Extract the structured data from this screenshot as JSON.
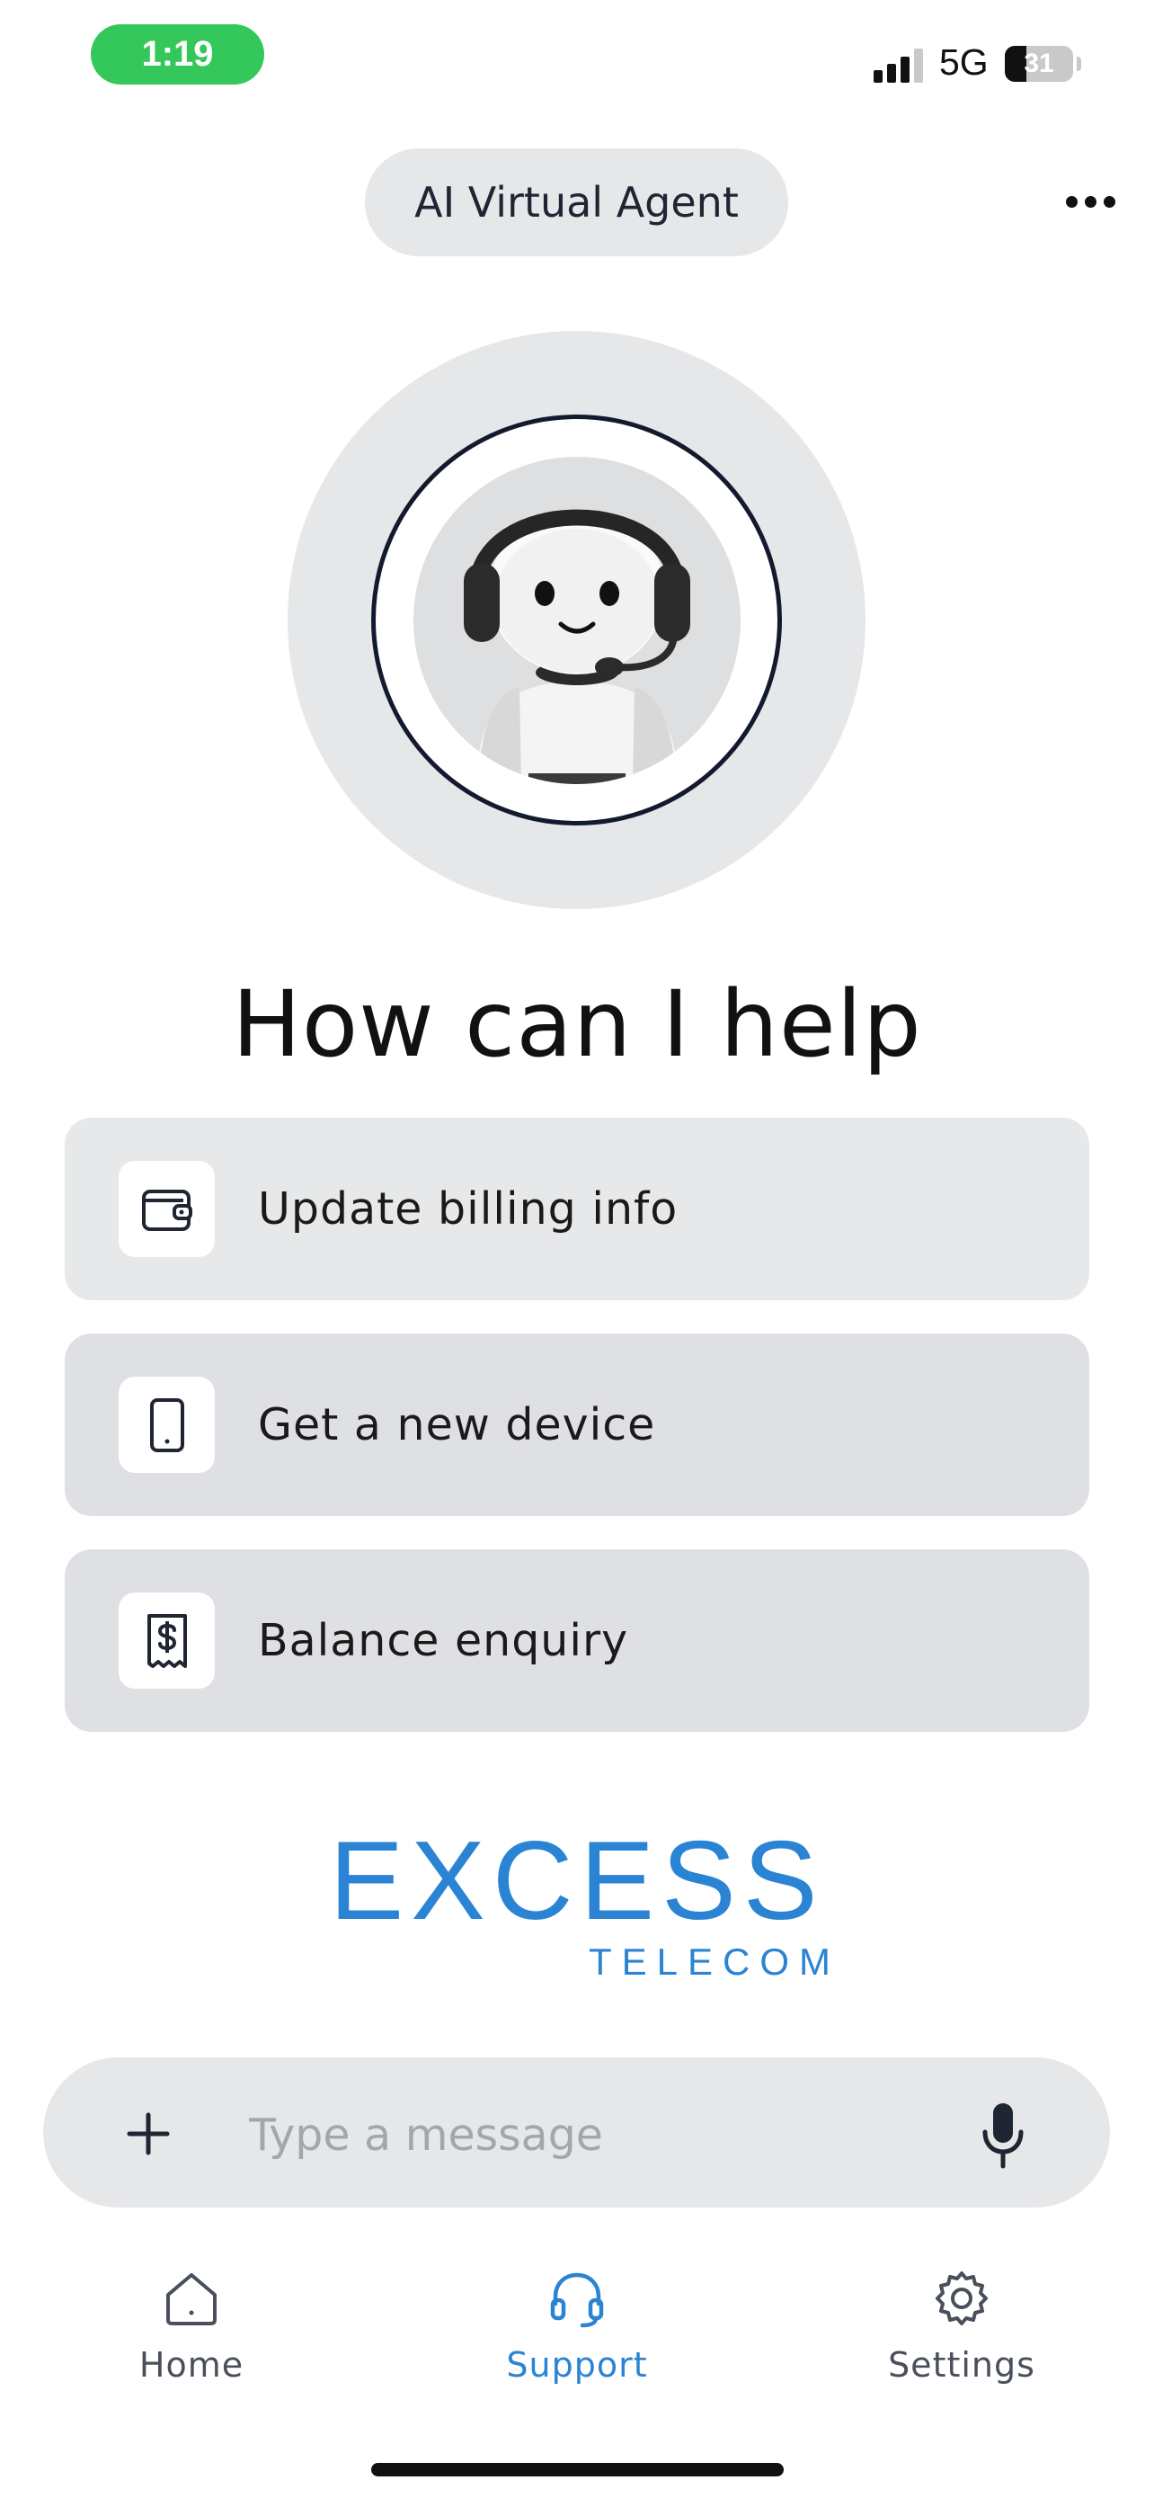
{
  "status_bar": {
    "time": "1:19",
    "network": "5G",
    "battery_level": 31,
    "battery_text": "31"
  },
  "header": {
    "title": "AI Virtual Agent",
    "more_icon": "more-horizontal-icon"
  },
  "avatar": {
    "icon": "robot-headset-avatar"
  },
  "headline": "How can I help",
  "options": [
    {
      "label": "Update billing info",
      "icon": "wallet-icon",
      "bg": "#e7e8ea"
    },
    {
      "label": "Get a new device",
      "icon": "phone-icon",
      "bg": "#dfe0e3"
    },
    {
      "label": "Balance enquiry",
      "icon": "receipt-dollar-icon",
      "bg": "#dfe0e3"
    }
  ],
  "logo": {
    "main": "EXCESS",
    "sub": "TELECOM",
    "color": "#2b84d3"
  },
  "composer": {
    "placeholder": "Type a message",
    "value": "",
    "add_icon": "plus-icon",
    "mic_icon": "microphone-icon"
  },
  "tabs": [
    {
      "label": "Home",
      "icon": "home-icon",
      "active": false
    },
    {
      "label": "Support",
      "icon": "headset-icon",
      "active": true
    },
    {
      "label": "Settings",
      "icon": "gear-icon",
      "active": false
    }
  ],
  "colors": {
    "accent": "#2b84d3",
    "inactive_tab": "#4a4f5c",
    "time_pill": "#34c759"
  }
}
